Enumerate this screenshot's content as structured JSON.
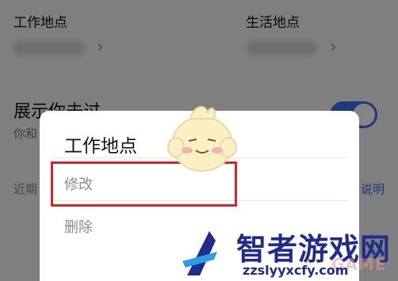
{
  "settings": {
    "work_location_label": "工作地点",
    "life_location_label": "生活地点",
    "show_visited_title": "展示你去过",
    "show_visited_sub": "你和",
    "recent_text": "近期",
    "explain_link": "说明"
  },
  "dialog": {
    "title": "工作地点",
    "option_edit": "修改",
    "option_delete": "删除"
  },
  "watermark": {
    "title": "智者游戏网",
    "domain": "zzslyyxcfy.com",
    "ghost": "GAME"
  }
}
